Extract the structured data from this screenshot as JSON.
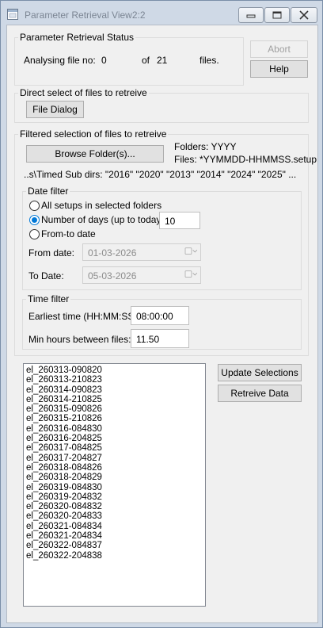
{
  "window": {
    "title": "Parameter Retrieval View2:2"
  },
  "status": {
    "group_label": "Parameter Retrieval Status",
    "analysing_label": "Analysing file no:",
    "current": "0",
    "of_label": "of",
    "total": "21",
    "files_label": "files."
  },
  "actions": {
    "abort_label": "Abort",
    "help_label": "Help"
  },
  "direct": {
    "group_label": "Direct select of files to retreive",
    "file_dialog_label": "File Dialog"
  },
  "filtered": {
    "group_label": "Filtered selection of files to retreive",
    "browse_label": "Browse Folder(s)...",
    "folders_text": "Folders: YYYY",
    "files_text": "Files: *YYMMDD-HHMMSS.setup",
    "subdirs_text": "..s\\Timed Sub dirs: \"2016\" \"2020\" \"2013\" \"2014\" \"2024\" \"2025\" ..."
  },
  "date_filter": {
    "group_label": "Date filter",
    "option_all": "All setups in selected folders",
    "option_days": "Number of days (up to today)",
    "days_value": "10",
    "option_fromto": "From-to date",
    "from_label": "From date:",
    "from_value": "01-03-2026",
    "to_label": "To Date:",
    "to_value": "05-03-2026",
    "selected": "days"
  },
  "time_filter": {
    "group_label": "Time filter",
    "earliest_label": "Earliest time (HH:MM:SS):",
    "earliest_value": "08:00:00",
    "min_hours_label": "Min hours between files:",
    "min_hours_value": "11.50"
  },
  "selection": {
    "update_label": "Update Selections",
    "retreive_label": "Retreive Data"
  },
  "files": [
    "el_260313-090820",
    "el_260313-210823",
    "el_260314-090823",
    "el_260314-210825",
    "el_260315-090826",
    "el_260315-210826",
    "el_260316-084830",
    "el_260316-204825",
    "el_260317-084825",
    "el_260317-204827",
    "el_260318-084826",
    "el_260318-204829",
    "el_260319-084830",
    "el_260319-204832",
    "el_260320-084832",
    "el_260320-204833",
    "el_260321-084834",
    "el_260321-204834",
    "el_260322-084837",
    "el_260322-204838"
  ],
  "colors": {
    "accent": "#0078d7",
    "titlebar": "#cfd9e6",
    "panel": "#f0f0f0"
  },
  "icons": [
    "app-icon",
    "minimize-icon",
    "maximize-icon",
    "close-icon",
    "calendar-icon",
    "chevron-down-icon"
  ]
}
